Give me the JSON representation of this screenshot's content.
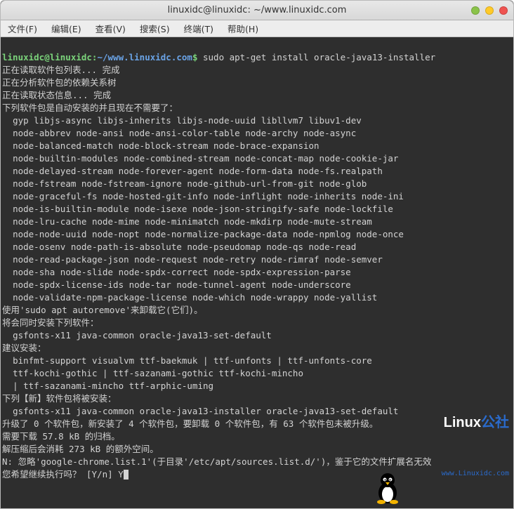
{
  "window": {
    "title": "linuxidc@linuxidc: ~/www.linuxidc.com"
  },
  "menubar": {
    "file": "文件(F)",
    "edit": "编辑(E)",
    "view": "查看(V)",
    "search": "搜索(S)",
    "terminal": "终端(T)",
    "help": "帮助(H)"
  },
  "prompt": {
    "userhost": "linuxidc@linuxidc:",
    "tilde": "~",
    "path": "/www.linuxidc.com",
    "dollar": "$",
    "command": "sudo apt-get install oracle-java13-installer"
  },
  "output": [
    "正在读取软件包列表... 完成",
    "正在分析软件包的依赖关系树",
    "正在读取状态信息... 完成",
    "下列软件包是自动安装的并且现在不需要了：",
    "  gyp libjs-async libjs-inherits libjs-node-uuid libllvm7 libuv1-dev",
    "  node-abbrev node-ansi node-ansi-color-table node-archy node-async",
    "  node-balanced-match node-block-stream node-brace-expansion",
    "  node-builtin-modules node-combined-stream node-concat-map node-cookie-jar",
    "  node-delayed-stream node-forever-agent node-form-data node-fs.realpath",
    "  node-fstream node-fstream-ignore node-github-url-from-git node-glob",
    "  node-graceful-fs node-hosted-git-info node-inflight node-inherits node-ini",
    "  node-is-builtin-module node-isexe node-json-stringify-safe node-lockfile",
    "  node-lru-cache node-mime node-minimatch node-mkdirp node-mute-stream",
    "  node-node-uuid node-nopt node-normalize-package-data node-npmlog node-once",
    "  node-osenv node-path-is-absolute node-pseudomap node-qs node-read",
    "  node-read-package-json node-request node-retry node-rimraf node-semver",
    "  node-sha node-slide node-spdx-correct node-spdx-expression-parse",
    "  node-spdx-license-ids node-tar node-tunnel-agent node-underscore",
    "  node-validate-npm-package-license node-which node-wrappy node-yallist",
    "使用'sudo apt autoremove'来卸载它(它们)。",
    "将会同时安装下列软件：",
    "  gsfonts-x11 java-common oracle-java13-set-default",
    "建议安装：",
    "  binfmt-support visualvm ttf-baekmuk | ttf-unfonts | ttf-unfonts-core",
    "  ttf-kochi-gothic | ttf-sazanami-gothic ttf-kochi-mincho",
    "  | ttf-sazanami-mincho ttf-arphic-uming",
    "下列【新】软件包将被安装：",
    "  gsfonts-x11 java-common oracle-java13-installer oracle-java13-set-default",
    "升级了 0 个软件包，新安装了 4 个软件包，要卸载 0 个软件包，有 63 个软件包未被升级。",
    "需要下载 57.8 kB 的归档。",
    "解压缩后会消耗 273 kB 的额外空间。",
    "N: 忽略'google-chrome.list.1'(于目录'/etc/apt/sources.list.d/')，鉴于它的文件扩展名无效"
  ],
  "confirm": {
    "q": "您希望继续执行吗？ [Y/n] ",
    "a": "Y"
  },
  "watermark": {
    "brand1": "Linux",
    "brand2": "公社",
    "url": "www.Linuxidc.com"
  }
}
